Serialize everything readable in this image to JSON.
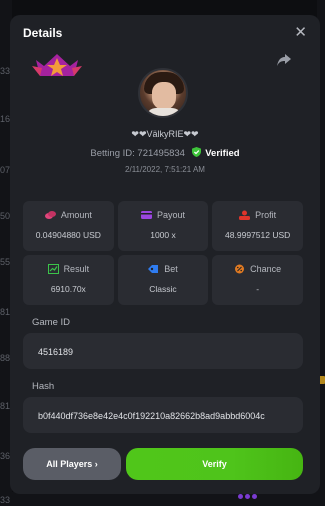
{
  "modal": {
    "title": "Details",
    "close_glyph": "✕"
  },
  "player": {
    "name": "❤❤VälkyRIE❤❤",
    "betting_id_label": "Betting ID:",
    "betting_id": "721495834",
    "verified_label": "Verified",
    "date": "2/11/2022, 7:51:21 AM"
  },
  "stats": [
    {
      "label": "Amount",
      "value": "0.04904880 USD",
      "icon": "coins-icon",
      "color": "#e0457b"
    },
    {
      "label": "Payout",
      "value": "1000 x",
      "icon": "wallet-icon",
      "color": "#9b46e0"
    },
    {
      "label": "Profit",
      "value": "48.9997512 USD",
      "icon": "profit-icon",
      "color": "#e0352b"
    },
    {
      "label": "Result",
      "value": "6910.70x",
      "icon": "chart-icon",
      "color": "#3bc44a"
    },
    {
      "label": "Bet",
      "value": "Classic",
      "icon": "tag-icon",
      "color": "#2f7cf0"
    },
    {
      "label": "Chance",
      "value": "-",
      "icon": "chance-icon",
      "color": "#e07a22"
    }
  ],
  "game_id": {
    "label": "Game ID",
    "value": "4516189"
  },
  "hash": {
    "label": "Hash",
    "value": "b0f440df736e8e42e4c0f192210a82662b8ad9abbd6004c"
  },
  "buttons": {
    "all_players": "All Players ›",
    "verify": "Verify"
  },
  "background": {
    "left_digits": [
      "33",
      "16",
      "07",
      "50",
      "55",
      "81",
      "88",
      "81",
      "36",
      "33"
    ]
  }
}
